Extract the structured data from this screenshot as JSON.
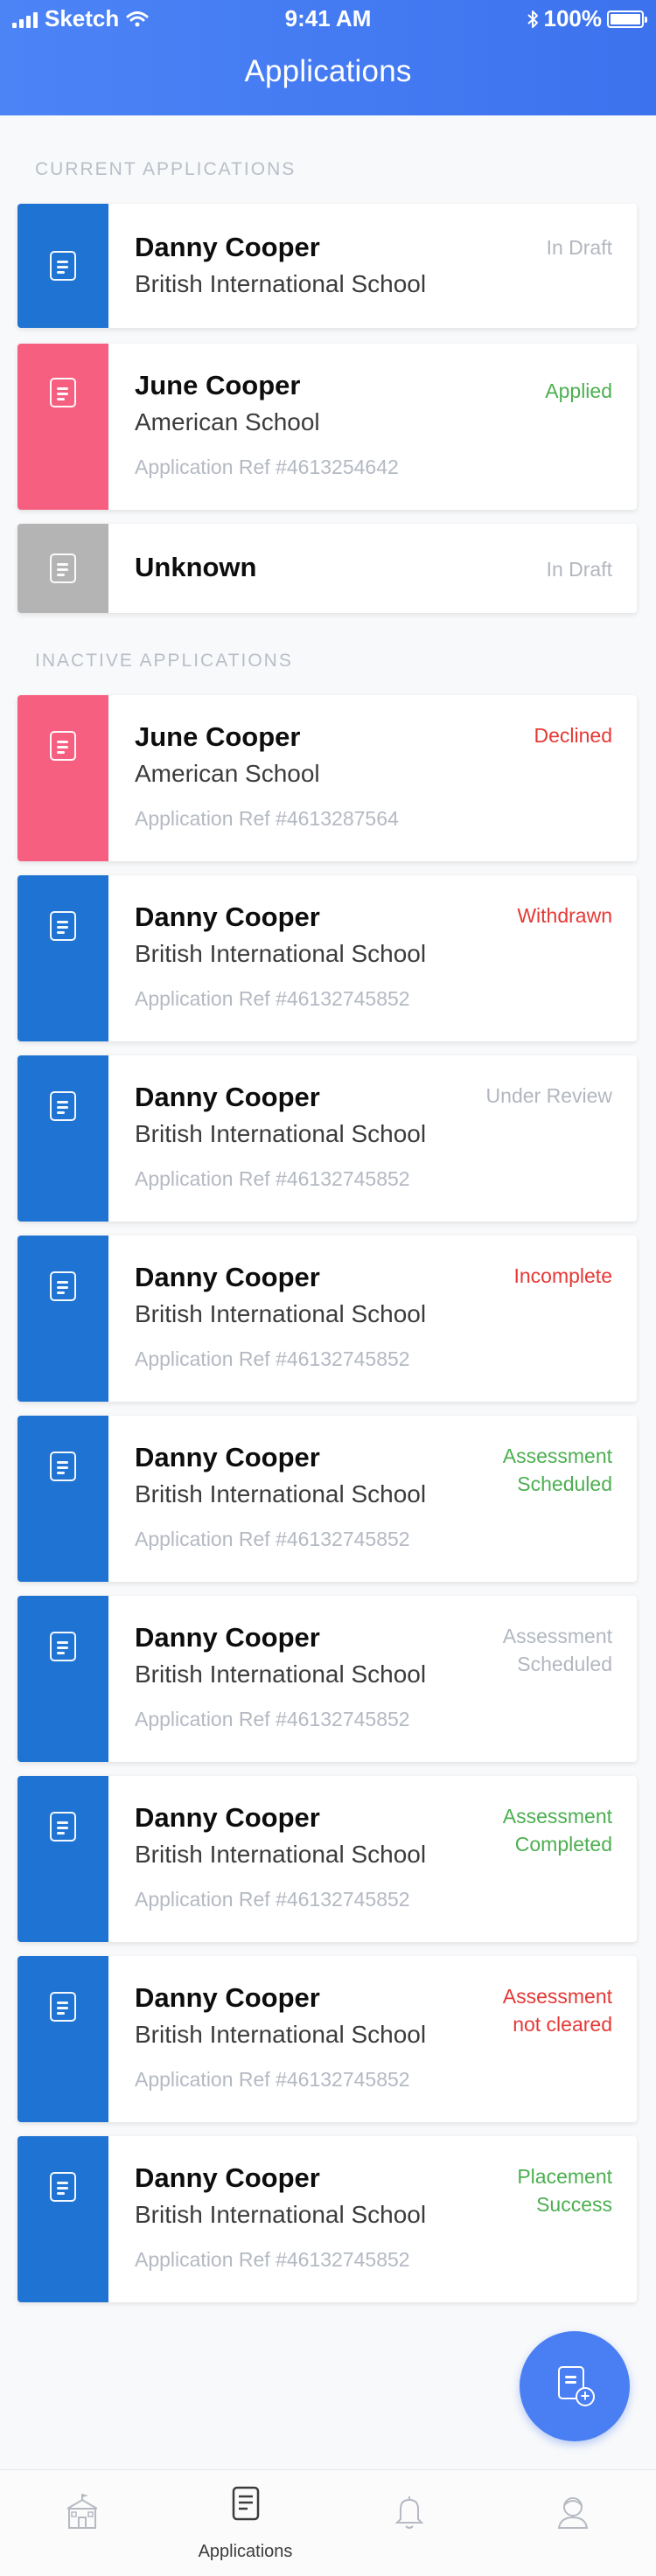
{
  "status_bar": {
    "carrier": "Sketch",
    "time": "9:41 AM",
    "battery": "100%"
  },
  "header": {
    "title": "Applications"
  },
  "sections": {
    "current_label": "CURRENT APPLICATIONS",
    "inactive_label": "INACTIVE APPLICATIONS"
  },
  "current_applications": [
    {
      "name": "Danny Cooper",
      "school": "British International School",
      "ref": "",
      "status": "In Draft",
      "status_color": "#b2b7bf",
      "stripe_color": "#1f74d3"
    },
    {
      "name": "June Cooper",
      "school": "American School",
      "ref": "Application Ref #4613254642",
      "status": "Applied",
      "status_color": "#4caf50",
      "stripe_color": "#f75f80"
    },
    {
      "name": "Unknown",
      "school": "",
      "ref": "",
      "status": "In Draft",
      "status_color": "#b2b7bf",
      "stripe_color": "#b4b4b4"
    }
  ],
  "inactive_applications": [
    {
      "name": "June Cooper",
      "school": "American School",
      "ref": "Application Ref #4613287564",
      "status_line1": "Declined",
      "status_line2": "",
      "status_color": "#e53935",
      "stripe_color": "#f75f80"
    },
    {
      "name": "Danny Cooper",
      "school": "British International School",
      "ref": "Application Ref #46132745852",
      "status_line1": "Withdrawn",
      "status_line2": "",
      "status_color": "#e53935",
      "stripe_color": "#1f74d3"
    },
    {
      "name": "Danny Cooper",
      "school": "British International School",
      "ref": "Application Ref #46132745852",
      "status_line1": "Under Review",
      "status_line2": "",
      "status_color": "#b2b7bf",
      "stripe_color": "#1f74d3"
    },
    {
      "name": "Danny Cooper",
      "school": "British International School",
      "ref": "Application Ref #46132745852",
      "status_line1": "Incomplete",
      "status_line2": "",
      "status_color": "#e53935",
      "stripe_color": "#1f74d3"
    },
    {
      "name": "Danny Cooper",
      "school": "British International School",
      "ref": "Application Ref #46132745852",
      "status_line1": "Assessment",
      "status_line2": "Scheduled",
      "status_color": "#4caf50",
      "stripe_color": "#1f74d3"
    },
    {
      "name": "Danny Cooper",
      "school": "British International School",
      "ref": "Application Ref #46132745852",
      "status_line1": "Assessment",
      "status_line2": "Scheduled",
      "status_color": "#b2b7bf",
      "stripe_color": "#1f74d3"
    },
    {
      "name": "Danny Cooper",
      "school": "British International School",
      "ref": "Application Ref #46132745852",
      "status_line1": "Assessment",
      "status_line2": "Completed",
      "status_color": "#4caf50",
      "stripe_color": "#1f74d3"
    },
    {
      "name": "Danny Cooper",
      "school": "British International School",
      "ref": "Application Ref #46132745852",
      "status_line1": "Assessment",
      "status_line2": "not cleared",
      "status_color": "#e53935",
      "stripe_color": "#1f74d3"
    },
    {
      "name": "Danny Cooper",
      "school": "British International School",
      "ref": "Application Ref #46132745852",
      "status_line1": "Placement",
      "status_line2": "Success",
      "status_color": "#4caf50",
      "stripe_color": "#1f74d3"
    }
  ],
  "fab": {
    "icon": "new-application-icon"
  },
  "tabbar": {
    "items": [
      {
        "icon": "school-icon",
        "label": ""
      },
      {
        "icon": "applications-icon",
        "label": "Applications"
      },
      {
        "icon": "bell-icon",
        "label": ""
      },
      {
        "icon": "profile-icon",
        "label": ""
      }
    ]
  }
}
